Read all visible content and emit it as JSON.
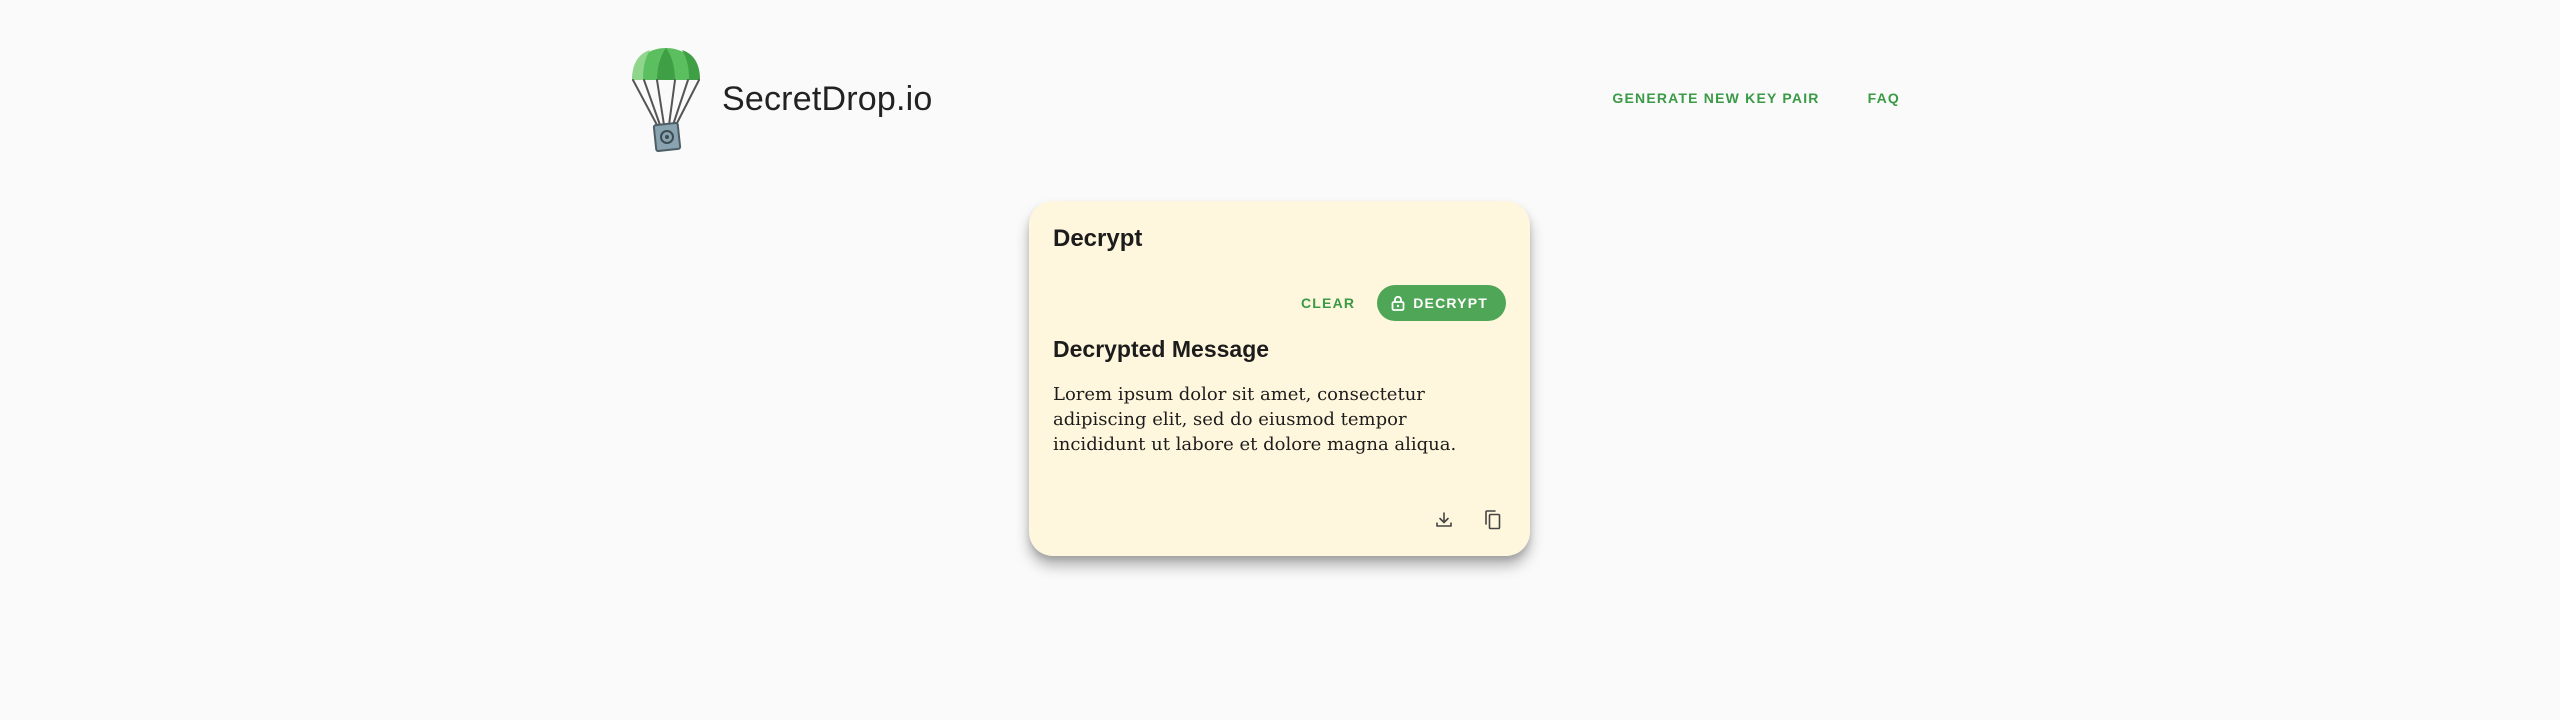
{
  "header": {
    "brand_name": "SecretDrop.io",
    "nav": [
      {
        "label": "GENERATE NEW KEY PAIR"
      },
      {
        "label": "FAQ"
      }
    ]
  },
  "card": {
    "title": "Decrypt",
    "actions": {
      "clear_label": "CLEAR",
      "decrypt_label": "DECRYPT",
      "decrypt_icon": "lock-icon"
    },
    "section_title": "Decrypted Message",
    "message": "Lorem ipsum dolor sit amet, consectetur adipiscing elit, sed do eiusmod tempor incididunt ut labore et dolore magna aliqua.",
    "footer_icons": [
      "download-icon",
      "copy-icon"
    ]
  },
  "colors": {
    "accent": "#4fa656",
    "accent_text": "#3a9a45",
    "card_background": "#fff7dd",
    "page_background": "#fafafa"
  }
}
